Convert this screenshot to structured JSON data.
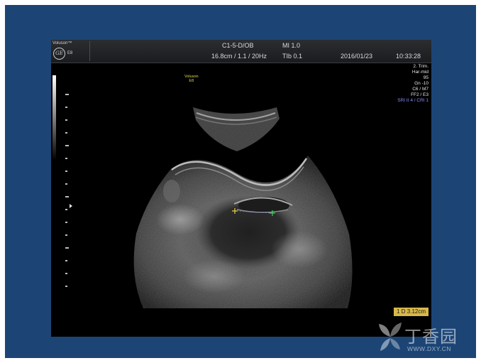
{
  "header": {
    "brand_name": "Voluson™",
    "brand_logo": "GE",
    "brand_model": "E8",
    "probe_mode": "C1-5-D/OB",
    "mi": "MI 1.0",
    "settings": "16.8cm / 1.1 / 20Hz",
    "tib": "TIb 0.1",
    "date": "2016/01/23",
    "time": "10:33:28"
  },
  "image_params": {
    "lines": [
      "2. Trim.",
      "Har-mid",
      "95",
      "Gn -10",
      "C6 / M7",
      "FF2 / E3"
    ],
    "sri": "SRI II 4 / CRI 1"
  },
  "probe_label": {
    "line1": "Voluson",
    "line2": "E8"
  },
  "measurement": {
    "label": "1  D 3.12cm",
    "caliper_color_1": "#e8d44a",
    "caliper_color_2": "#3ccf5a"
  },
  "watermark": {
    "text": "丁香园",
    "url": "WWW.DXY.CN"
  },
  "colors": {
    "slide_background": "#1c4576",
    "monitor_background": "#000000",
    "measure_box": "#d8b84a"
  }
}
